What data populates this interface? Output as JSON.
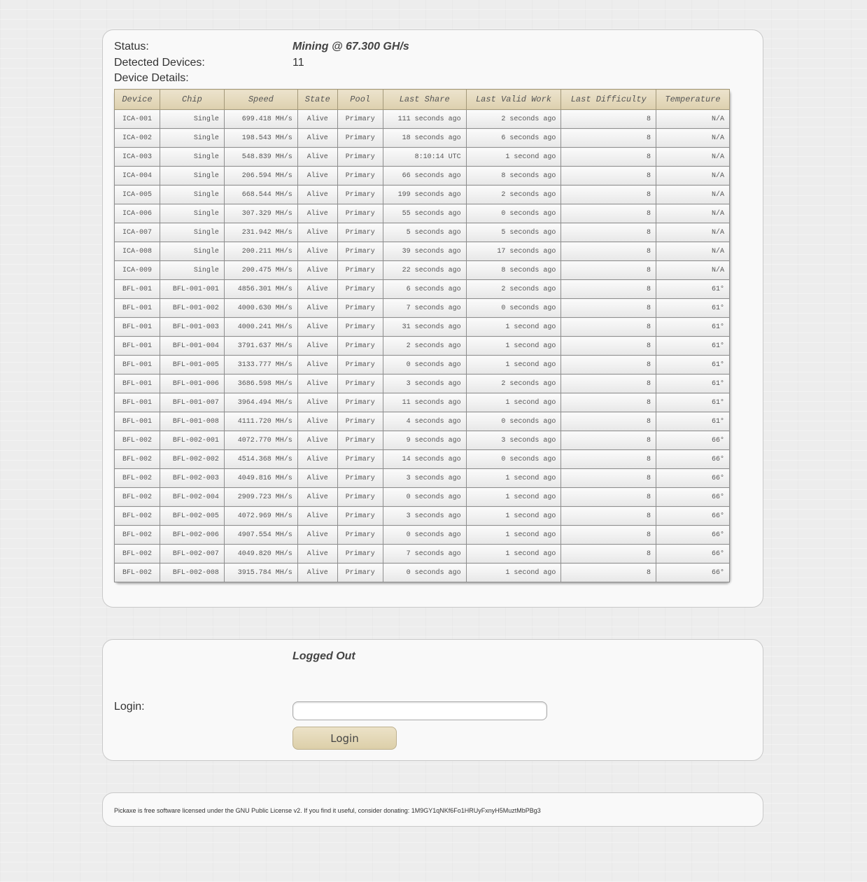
{
  "status": {
    "status_label": "Status:",
    "status_value": "Mining @ 67.300 GH/s",
    "detected_label": "Detected Devices:",
    "detected_value": "11",
    "details_label": "Device Details:"
  },
  "table": {
    "headers": [
      "Device",
      "Chip",
      "Speed",
      "State",
      "Pool",
      "Last Share",
      "Last Valid Work",
      "Last Difficulty",
      "Temperature"
    ],
    "rows": [
      [
        "ICA-001",
        "Single",
        "699.418 MH/s",
        "Alive",
        "Primary",
        "111 seconds ago",
        "2 seconds ago",
        "8",
        "N/A"
      ],
      [
        "ICA-002",
        "Single",
        "198.543 MH/s",
        "Alive",
        "Primary",
        "18 seconds ago",
        "6 seconds ago",
        "8",
        "N/A"
      ],
      [
        "ICA-003",
        "Single",
        "548.839 MH/s",
        "Alive",
        "Primary",
        "8:10:14 UTC",
        "1 second ago",
        "8",
        "N/A"
      ],
      [
        "ICA-004",
        "Single",
        "206.594 MH/s",
        "Alive",
        "Primary",
        "66 seconds ago",
        "8 seconds ago",
        "8",
        "N/A"
      ],
      [
        "ICA-005",
        "Single",
        "668.544 MH/s",
        "Alive",
        "Primary",
        "199 seconds ago",
        "2 seconds ago",
        "8",
        "N/A"
      ],
      [
        "ICA-006",
        "Single",
        "307.329 MH/s",
        "Alive",
        "Primary",
        "55 seconds ago",
        "0 seconds ago",
        "8",
        "N/A"
      ],
      [
        "ICA-007",
        "Single",
        "231.942 MH/s",
        "Alive",
        "Primary",
        "5 seconds ago",
        "5 seconds ago",
        "8",
        "N/A"
      ],
      [
        "ICA-008",
        "Single",
        "200.211 MH/s",
        "Alive",
        "Primary",
        "39 seconds ago",
        "17 seconds ago",
        "8",
        "N/A"
      ],
      [
        "ICA-009",
        "Single",
        "200.475 MH/s",
        "Alive",
        "Primary",
        "22 seconds ago",
        "8 seconds ago",
        "8",
        "N/A"
      ],
      [
        "BFL-001",
        "BFL-001-001",
        "4856.301 MH/s",
        "Alive",
        "Primary",
        "6 seconds ago",
        "2 seconds ago",
        "8",
        "61°"
      ],
      [
        "BFL-001",
        "BFL-001-002",
        "4000.630 MH/s",
        "Alive",
        "Primary",
        "7 seconds ago",
        "0 seconds ago",
        "8",
        "61°"
      ],
      [
        "BFL-001",
        "BFL-001-003",
        "4000.241 MH/s",
        "Alive",
        "Primary",
        "31 seconds ago",
        "1 second ago",
        "8",
        "61°"
      ],
      [
        "BFL-001",
        "BFL-001-004",
        "3791.637 MH/s",
        "Alive",
        "Primary",
        "2 seconds ago",
        "1 second ago",
        "8",
        "61°"
      ],
      [
        "BFL-001",
        "BFL-001-005",
        "3133.777 MH/s",
        "Alive",
        "Primary",
        "0 seconds ago",
        "1 second ago",
        "8",
        "61°"
      ],
      [
        "BFL-001",
        "BFL-001-006",
        "3686.598 MH/s",
        "Alive",
        "Primary",
        "3 seconds ago",
        "2 seconds ago",
        "8",
        "61°"
      ],
      [
        "BFL-001",
        "BFL-001-007",
        "3964.494 MH/s",
        "Alive",
        "Primary",
        "11 seconds ago",
        "1 second ago",
        "8",
        "61°"
      ],
      [
        "BFL-001",
        "BFL-001-008",
        "4111.720 MH/s",
        "Alive",
        "Primary",
        "4 seconds ago",
        "0 seconds ago",
        "8",
        "61°"
      ],
      [
        "BFL-002",
        "BFL-002-001",
        "4072.770 MH/s",
        "Alive",
        "Primary",
        "9 seconds ago",
        "3 seconds ago",
        "8",
        "66°"
      ],
      [
        "BFL-002",
        "BFL-002-002",
        "4514.368 MH/s",
        "Alive",
        "Primary",
        "14 seconds ago",
        "0 seconds ago",
        "8",
        "66°"
      ],
      [
        "BFL-002",
        "BFL-002-003",
        "4049.816 MH/s",
        "Alive",
        "Primary",
        "3 seconds ago",
        "1 second ago",
        "8",
        "66°"
      ],
      [
        "BFL-002",
        "BFL-002-004",
        "2909.723 MH/s",
        "Alive",
        "Primary",
        "0 seconds ago",
        "1 second ago",
        "8",
        "66°"
      ],
      [
        "BFL-002",
        "BFL-002-005",
        "4072.969 MH/s",
        "Alive",
        "Primary",
        "3 seconds ago",
        "1 second ago",
        "8",
        "66°"
      ],
      [
        "BFL-002",
        "BFL-002-006",
        "4907.554 MH/s",
        "Alive",
        "Primary",
        "0 seconds ago",
        "1 second ago",
        "8",
        "66°"
      ],
      [
        "BFL-002",
        "BFL-002-007",
        "4049.820 MH/s",
        "Alive",
        "Primary",
        "7 seconds ago",
        "1 second ago",
        "8",
        "66°"
      ],
      [
        "BFL-002",
        "BFL-002-008",
        "3915.784 MH/s",
        "Alive",
        "Primary",
        "0 seconds ago",
        "1 second ago",
        "8",
        "66°"
      ]
    ]
  },
  "login": {
    "state": "Logged Out",
    "label": "Login:",
    "input_value": "",
    "button_label": "Login"
  },
  "footer": {
    "text": "Pickaxe is free software licensed under the GNU Public License v2. If you find it useful, consider donating: 1M9GY1qNKf6Fo1HRUyFxnyH5MuztMbPBg3"
  },
  "colors": {
    "header_bg": "#e3d8bb",
    "button_bg": "#e4d9bc",
    "panel_bg": "#f9f9f9",
    "page_bg": "#ededed"
  }
}
